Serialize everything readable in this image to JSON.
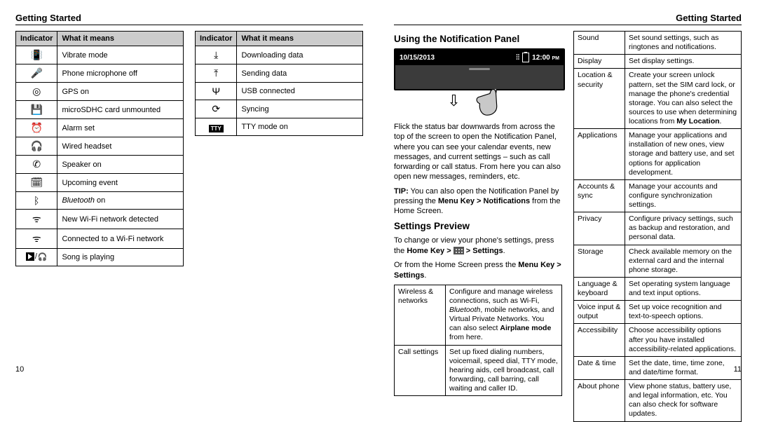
{
  "header": {
    "left": "Getting Started",
    "right": "Getting Started"
  },
  "pageNumbers": {
    "left": "10",
    "right": "11"
  },
  "indicatorHeader": {
    "col1": "Indicator",
    "col2": "What it means"
  },
  "leftTable": [
    {
      "icon": "📳",
      "name": "vibrate-icon",
      "text": "Vibrate mode"
    },
    {
      "icon": "🎤",
      "name": "mic-off-icon",
      "text": "Phone microphone off"
    },
    {
      "icon": "◎",
      "name": "gps-icon",
      "text": "GPS on"
    },
    {
      "icon": "💾",
      "name": "sd-icon",
      "text": "microSDHC card unmounted"
    },
    {
      "icon": "⏰",
      "name": "alarm-icon",
      "text": "Alarm set"
    },
    {
      "icon": "🎧",
      "name": "headset-icon",
      "text": "Wired headset"
    },
    {
      "icon": "✆",
      "name": "speaker-icon",
      "text": "Speaker on"
    },
    {
      "icon": "🗓",
      "name": "calendar-icon",
      "text": "Upcoming event"
    },
    {
      "icon": "ᛒ",
      "name": "bluetooth-icon",
      "italic": "Bluetooth",
      "rest": " on"
    },
    {
      "icon": "ᯤ",
      "name": "wifi-new-icon",
      "text": "New Wi-Fi network detected"
    },
    {
      "icon": "ᯤ",
      "name": "wifi-conn-icon",
      "text": "Connected to a Wi-Fi network"
    },
    {
      "icon": "play",
      "name": "play-icon",
      "text": "Song is playing"
    }
  ],
  "rightTable": [
    {
      "icon": "⤓",
      "name": "download-icon",
      "text": "Downloading data"
    },
    {
      "icon": "⤒",
      "name": "upload-icon",
      "text": "Sending data"
    },
    {
      "icon": "Ψ",
      "name": "usb-icon",
      "text": "USB connected"
    },
    {
      "icon": "⟳",
      "name": "sync-icon",
      "text": "Syncing"
    },
    {
      "icon": "TTY",
      "name": "tty-icon",
      "text": "TTY mode on"
    }
  ],
  "right": {
    "notifHeading": "Using the Notification Panel",
    "date": "10/15/2013",
    "time": "12:00",
    "ampm": "PM",
    "notifPara": "Flick the status bar downwards from across the top of the screen to open the Notification Panel, where you can see your calendar events, new messages, and current settings – such as call forwarding or call status. From here you can also open new messages, reminders, etc.",
    "tipLabel": "TIP:",
    "tipText": " You can also open the Notification Panel by pressing the ",
    "tipBold": "Menu Key > Notifications",
    "tipText2": " from the Home Screen.",
    "settingsHeading": "Settings Preview",
    "sp1": "To change or view your phone's settings, press the ",
    "sp1b": "Home Key > ",
    "sp1c": " > Settings",
    "sp2a": "Or from the Home Screen press the ",
    "sp2b": "Menu Key > Settings",
    "settingsTable1": [
      {
        "label": "Wireless & networks",
        "desc": [
          "Configure and manage wireless connections, such as Wi-Fi, ",
          {
            "i": "Bluetooth"
          },
          ", mobile networks, and Virtual Private Networks. You can also select ",
          {
            "b": "Airplane mode"
          },
          " from here."
        ]
      },
      {
        "label": "Call settings",
        "desc": [
          "Set up fixed dialing numbers, voicemail, speed dial, TTY mode, hearing aids, cell broadcast, call forwarding, call barring, call waiting and caller ID."
        ]
      }
    ],
    "settingsTable2": [
      {
        "label": "Sound",
        "desc": [
          "Set sound settings, such as ringtones and notifications."
        ]
      },
      {
        "label": "Display",
        "desc": [
          "Set display settings."
        ]
      },
      {
        "label": "Location & security",
        "desc": [
          "Create your screen unlock pattern, set the SIM card lock, or manage the phone's credential storage. You can also select the sources to use when determining locations from ",
          {
            "b": "My Location"
          },
          "."
        ]
      },
      {
        "label": "Applications",
        "desc": [
          "Manage your applications and installation of new ones, view storage and battery use, and set options for application development."
        ]
      },
      {
        "label": "Accounts & sync",
        "desc": [
          "Manage your accounts and configure synchronization settings."
        ]
      },
      {
        "label": "Privacy",
        "desc": [
          "Configure privacy settings, such as backup and restoration, and personal data."
        ]
      },
      {
        "label": "Storage",
        "desc": [
          "Check available memory on the external card and the internal phone storage."
        ]
      },
      {
        "label": "Language & keyboard",
        "desc": [
          "Set operating system language and text input options."
        ]
      },
      {
        "label": "Voice input & output",
        "desc": [
          "Set up voice recognition and text-to-speech options."
        ]
      },
      {
        "label": "Accessibility",
        "desc": [
          "Choose accessibility options after you have installed accessibility-related applications."
        ]
      },
      {
        "label": "Date & time",
        "desc": [
          "Set the date, time, time zone, and date/time format."
        ]
      },
      {
        "label": "About phone",
        "desc": [
          "View phone status, battery use, and legal information, etc. You can also check for software updates."
        ]
      }
    ]
  }
}
